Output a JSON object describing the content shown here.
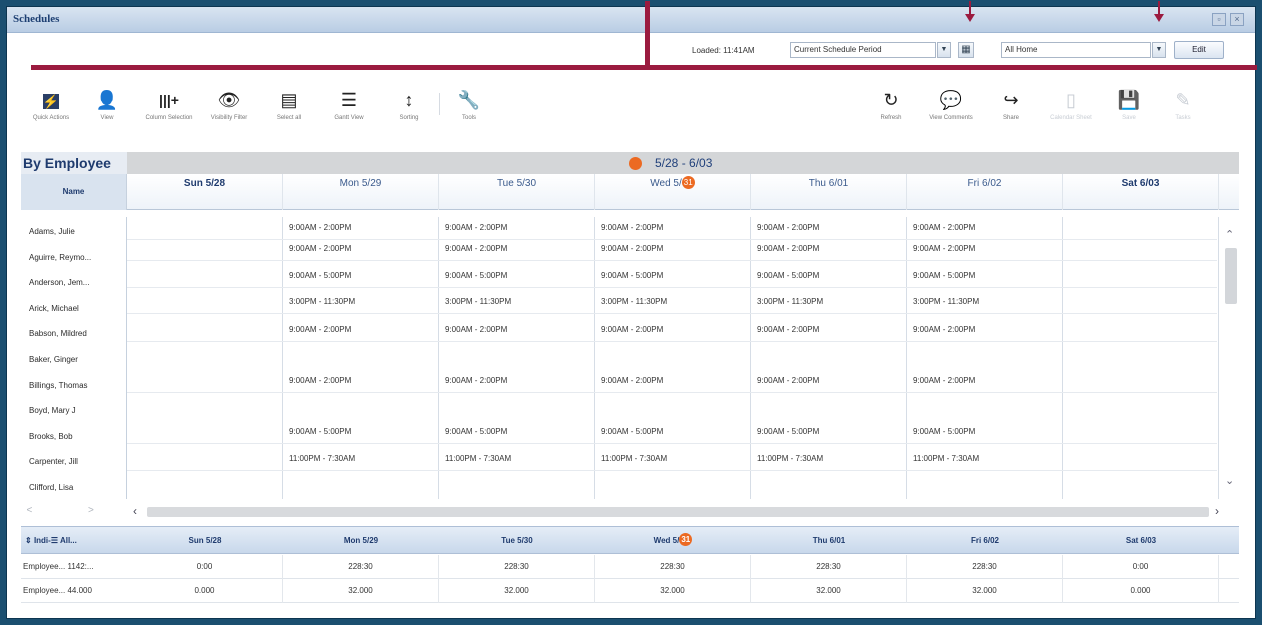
{
  "window": {
    "title": "Schedules"
  },
  "loaded": {
    "text": "Loaded: 11:41AM",
    "period": "Current Schedule Period",
    "location": "All Home",
    "edit_label": "Edit"
  },
  "toolbar": [
    {
      "icon": "⚡",
      "label": "Quick Actions"
    },
    {
      "icon": "👤",
      "label": "View"
    },
    {
      "icon": "|||+",
      "label": "Column Selection"
    },
    {
      "icon": "👁",
      "label": "Visibility Filter"
    },
    {
      "icon": "▤",
      "label": "Select all"
    },
    {
      "icon": "☰",
      "label": "Gantt View"
    },
    {
      "icon": "↕",
      "label": "Sorting"
    },
    {
      "icon": "🔧",
      "label": "Tools"
    },
    {
      "icon": "↻",
      "label": "Refresh"
    },
    {
      "icon": "💬",
      "label": "View Comments"
    },
    {
      "icon": "↪",
      "label": "Share"
    },
    {
      "icon": "▯",
      "label": "Calendar Sheet"
    },
    {
      "icon": "💾",
      "label": "Save"
    },
    {
      "icon": "✎",
      "label": "Tasks"
    }
  ],
  "grid": {
    "by_employee": "By Employee",
    "name_header": "Name",
    "date_range": "5/28 - 6/03",
    "days": [
      {
        "label": "Sun 5/28",
        "weekend": true
      },
      {
        "label": "Mon 5/29",
        "weekend": false
      },
      {
        "label": "Tue 5/30",
        "weekend": false
      },
      {
        "label": "Wed 5/",
        "badge": "31",
        "weekend": false
      },
      {
        "label": "Thu 6/01",
        "weekend": false
      },
      {
        "label": "Fri 6/02",
        "weekend": false
      },
      {
        "label": "Sat 6/03",
        "weekend": true
      }
    ],
    "employees": [
      "Adams, Julie",
      "Aguirre, Reymo...",
      "Anderson, Jem...",
      "Arick, Michael",
      "Babson, Mildred",
      "Baker, Ginger",
      "Billings, Thomas",
      "Boyd, Mary J",
      "Brooks, Bob",
      "Carpenter, Jill",
      "Clifford, Lisa"
    ],
    "shift_rows": [
      "9:00AM - 2:00PM",
      "9:00AM - 2:00PM",
      "9:00AM - 5:00PM",
      "3:00PM - 11:30PM",
      "9:00AM - 2:00PM",
      "9:00AM - 2:00PM",
      "9:00AM - 5:00PM",
      "11:00PM - 7:30AM"
    ]
  },
  "summary": {
    "header_label": "Indi-",
    "header_all": "All...",
    "days": [
      "Sun 5/28",
      "Mon 5/29",
      "Tue 5/30",
      "Wed 5/",
      "Thu 6/01",
      "Fri 6/02",
      "Sat 6/03"
    ],
    "wed_badge": "31",
    "rows": [
      {
        "label": "Employee...",
        "value": "1142:...",
        "cells": [
          "0:00",
          "228:30",
          "228:30",
          "228:30",
          "228:30",
          "228:30",
          "0:00"
        ]
      },
      {
        "label": "Employee...",
        "value": "44.000",
        "cells": [
          "0.000",
          "32.000",
          "32.000",
          "32.000",
          "32.000",
          "32.000",
          "0.000"
        ]
      }
    ]
  },
  "colors": {
    "annotation": "#9b1b3f",
    "accent": "#ec6a22",
    "frame": "#1b4f70"
  }
}
